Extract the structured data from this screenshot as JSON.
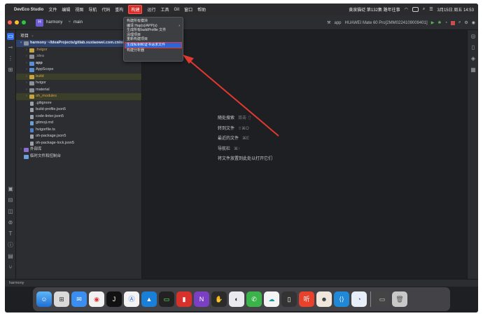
{
  "menubar": {
    "app_name": "DevEco Studio",
    "items": [
      "文件",
      "编辑",
      "视图",
      "导航",
      "代码",
      "重构",
      "构建",
      "运行",
      "工具",
      "Git",
      "窗口",
      "帮助"
    ],
    "active_item": "构建",
    "right": {
      "rank": "黄泉猫砭 第132集 路年往事",
      "datetime": "3月15日 周五 14:53"
    }
  },
  "toolbar": {
    "project_badge": "H",
    "project_name": "harmony",
    "branch": "main",
    "run_config": "app",
    "device": "HUAWEI Mate 60 Pro[2MM0224109009401]"
  },
  "build_menu": {
    "items": [
      {
        "label": "构建所有模块"
      },
      {
        "label": "编译 Hap(s)/APP(s)",
        "submenu": "›"
      },
      {
        "label": "生成所有buildProfile 文件"
      },
      {
        "label": "清理项目"
      },
      {
        "label": "重新构建项目"
      },
      {
        "label": "生成私钥和证书请求文件",
        "highlighted": true
      },
      {
        "label": "构建分析器"
      }
    ]
  },
  "project_panel": {
    "title": "项目",
    "tree": [
      {
        "label": "harmony ~/IdeaProjects/gitlab.xuxiaowei.com.cn/xuxiaowei-harmony/harmony",
        "depth": 0,
        "kind": "root",
        "expanded": true
      },
      {
        "label": ".hvigor",
        "depth": 1,
        "kind": "folder-orange"
      },
      {
        "label": ".idea",
        "depth": 1,
        "kind": "folder-gray"
      },
      {
        "label": "app",
        "depth": 1,
        "kind": "folder-yellow"
      },
      {
        "label": "AppScope",
        "depth": 1,
        "kind": "folder-yellow"
      },
      {
        "label": "build",
        "depth": 1,
        "kind": "folder-orange"
      },
      {
        "label": "hvigor",
        "depth": 1,
        "kind": "folder-gray"
      },
      {
        "label": "material",
        "depth": 1,
        "kind": "folder-gray"
      },
      {
        "label": "oh_modules",
        "depth": 1,
        "kind": "folder-orange"
      },
      {
        "label": ".gitignore",
        "depth": 1,
        "kind": "file"
      },
      {
        "label": "build-profile.json5",
        "depth": 1,
        "kind": "file"
      },
      {
        "label": "code-linter.json5",
        "depth": 1,
        "kind": "file"
      },
      {
        "label": "gitmoji.md",
        "depth": 1,
        "kind": "file"
      },
      {
        "label": "hvigorfile.ts",
        "depth": 1,
        "kind": "file"
      },
      {
        "label": "oh-package.json5",
        "depth": 1,
        "kind": "file"
      },
      {
        "label": "oh-package-lock.json5",
        "depth": 1,
        "kind": "file"
      },
      {
        "label": "外部库",
        "depth": 0,
        "kind": "lib"
      },
      {
        "label": "临时文件和控制台",
        "depth": 0,
        "kind": "scratch"
      }
    ]
  },
  "editor_hints": [
    {
      "label": "随处搜索",
      "shortcut": "双击 ⇧"
    },
    {
      "label": "转到文件",
      "shortcut": "⇧⌘O"
    },
    {
      "label": "最近的文件",
      "shortcut": "⌘E"
    },
    {
      "label": "导航栏",
      "shortcut": "⌘↑"
    },
    {
      "label": "将文件放置到此处以打开它们",
      "shortcut": ""
    }
  ],
  "statusbar": {
    "path": "harmony"
  },
  "colors": {
    "accent": "#3574f0",
    "annotation_red": "#e0392f"
  }
}
